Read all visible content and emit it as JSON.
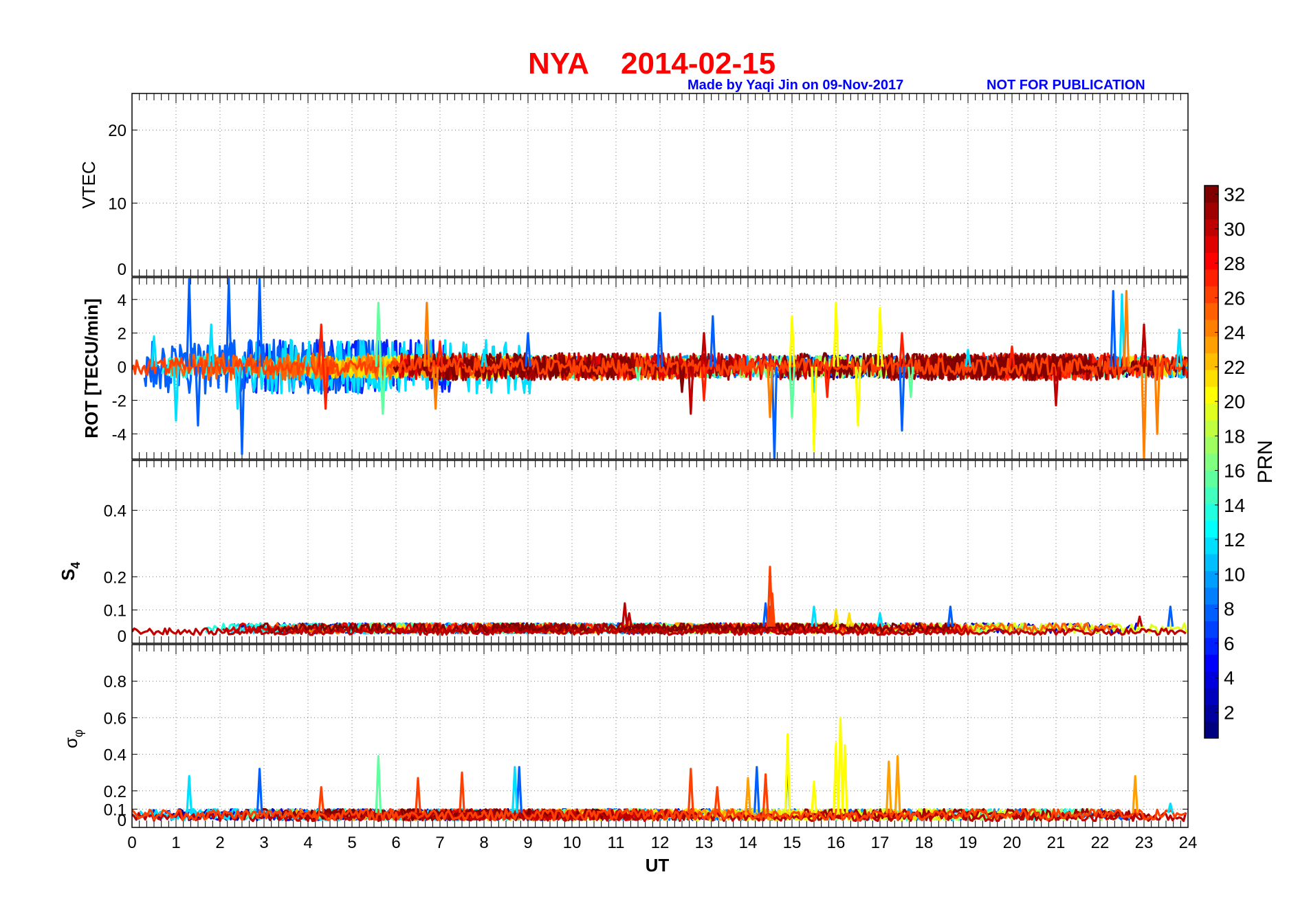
{
  "header": {
    "station": "NYA",
    "date": "2014-02-15",
    "credit": "Made by Yaqi Jin on 09-Nov-2017",
    "notice": "NOT FOR PUBLICATION"
  },
  "colorbar": {
    "label": "PRN",
    "ticks": [
      "2",
      "4",
      "6",
      "8",
      "10",
      "12",
      "14",
      "16",
      "18",
      "20",
      "22",
      "24",
      "26",
      "28",
      "30",
      "32"
    ],
    "range": [
      1,
      33
    ],
    "colormap": "jet"
  },
  "chart_data": [
    {
      "type": "line",
      "panel": "vtec",
      "title": "NYA 2014-02-15",
      "ylabel": "VTEC",
      "xlabel": "",
      "xlim": [
        0,
        24
      ],
      "ylim": [
        0,
        25
      ],
      "yticks": [
        "0",
        "10",
        "20"
      ],
      "grid": true,
      "series": []
    },
    {
      "type": "line",
      "panel": "rot",
      "ylabel": "ROT [TECU/min]",
      "xlabel": "",
      "xlim": [
        0,
        24
      ],
      "ylim": [
        -5.5,
        5.3
      ],
      "yticks": [
        "-4",
        "-2",
        "0",
        "2",
        "4"
      ],
      "grid": true,
      "series": [
        {
          "prn": 8,
          "x": [
            1.3,
            1.5,
            2.2,
            2.5,
            2.9,
            9.0,
            12.0,
            13.2,
            14.6,
            17.5,
            22.3
          ],
          "y": [
            5.2,
            -3.5,
            5.2,
            -5.2,
            5.2,
            2.0,
            3.2,
            3.0,
            -5.5,
            -3.8,
            4.5
          ]
        },
        {
          "prn": 12,
          "x": [
            0.5,
            1.0,
            1.8,
            2.4,
            4.0,
            8.0,
            10.5,
            15.5,
            19.0,
            22.5,
            23.8
          ],
          "y": [
            1.8,
            -3.2,
            2.5,
            -2.5,
            1.0,
            1.0,
            0.8,
            -1.5,
            1.0,
            4.3,
            2.2
          ]
        },
        {
          "prn": 16,
          "x": [
            5.6,
            5.7,
            11.5,
            15.0,
            17.7
          ],
          "y": [
            3.8,
            -2.8,
            -0.8,
            -3.0,
            -1.8
          ]
        },
        {
          "prn": 21,
          "x": [
            15.0,
            15.5,
            16.0,
            16.5,
            17.0
          ],
          "y": [
            3.0,
            -5.0,
            3.8,
            -3.5,
            3.5
          ]
        },
        {
          "prn": 25,
          "x": [
            6.7,
            6.9,
            14.5,
            22.6,
            23.0,
            23.3
          ],
          "y": [
            3.8,
            -2.5,
            -3.0,
            4.5,
            -5.5,
            -4.0
          ]
        },
        {
          "prn": 28,
          "x": [
            4.3,
            4.4,
            7.0,
            13.0,
            15.8,
            17.5,
            20.0
          ],
          "y": [
            2.5,
            -2.5,
            1.5,
            -2.0,
            -1.8,
            2.0,
            1.2
          ]
        },
        {
          "prn": 31,
          "x": [
            7.5,
            10.5,
            12.7,
            13.0,
            21.0,
            23.0
          ],
          "y": [
            0.2,
            0.8,
            -2.8,
            2.0,
            -2.3,
            2.5
          ]
        },
        {
          "prn": 33,
          "x": [
            6.0,
            9.0,
            12.5,
            19.5,
            22.0
          ],
          "y": [
            -0.3,
            -0.5,
            -1.5,
            -0.5,
            -0.7
          ]
        }
      ]
    },
    {
      "type": "line",
      "panel": "s4",
      "ylabel": "S4",
      "xlabel": "",
      "xlim": [
        0,
        24
      ],
      "ylim": [
        0,
        0.55
      ],
      "yticks": [
        "0",
        "0.1",
        "0.2",
        "0.4"
      ],
      "grid": true,
      "series": [
        {
          "prn": 8,
          "x": [
            14.4,
            14.5,
            18.6,
            23.6
          ],
          "y": [
            0.12,
            0.11,
            0.11,
            0.11
          ]
        },
        {
          "prn": 12,
          "x": [
            15.5,
            16.0,
            17.0
          ],
          "y": [
            0.11,
            0.09,
            0.09
          ]
        },
        {
          "prn": 22,
          "x": [
            16.0,
            16.3
          ],
          "y": [
            0.1,
            0.09
          ]
        },
        {
          "prn": 27,
          "x": [
            14.5,
            14.55
          ],
          "y": [
            0.23,
            0.15
          ]
        },
        {
          "prn": 31,
          "x": [
            11.2,
            11.3,
            22.9
          ],
          "y": [
            0.12,
            0.09,
            0.08
          ]
        }
      ]
    },
    {
      "type": "line",
      "panel": "sigma_phi",
      "ylabel": "σφ",
      "xlabel": "UT",
      "xlim": [
        0,
        24
      ],
      "ylim": [
        0,
        1
      ],
      "yticks": [
        "0",
        "0.1",
        "0.2",
        "0.4",
        "0.6",
        "0.8"
      ],
      "xticks": [
        "0",
        "1",
        "2",
        "3",
        "4",
        "5",
        "6",
        "7",
        "8",
        "9",
        "10",
        "11",
        "12",
        "13",
        "14",
        "15",
        "16",
        "17",
        "18",
        "19",
        "20",
        "21",
        "22",
        "23",
        "24"
      ],
      "grid": true,
      "series": [
        {
          "prn": 8,
          "x": [
            2.9,
            8.8,
            14.2,
            14.9
          ],
          "y": [
            0.32,
            0.33,
            0.33,
            0.38
          ]
        },
        {
          "prn": 12,
          "x": [
            1.3,
            8.7,
            23.6
          ],
          "y": [
            0.28,
            0.33,
            0.13
          ]
        },
        {
          "prn": 16,
          "x": [
            5.6
          ],
          "y": [
            0.39
          ]
        },
        {
          "prn": 21,
          "x": [
            14.9,
            15.5,
            16.0,
            16.1,
            16.2
          ],
          "y": [
            0.51,
            0.25,
            0.46,
            0.6,
            0.45
          ]
        },
        {
          "prn": 24,
          "x": [
            14.0,
            17.2,
            17.4,
            22.8
          ],
          "y": [
            0.27,
            0.36,
            0.39,
            0.28
          ]
        },
        {
          "prn": 27,
          "x": [
            4.3,
            6.5,
            7.5,
            12.7,
            13.3,
            14.4
          ],
          "y": [
            0.22,
            0.27,
            0.3,
            0.32,
            0.22,
            0.29
          ]
        }
      ]
    }
  ]
}
